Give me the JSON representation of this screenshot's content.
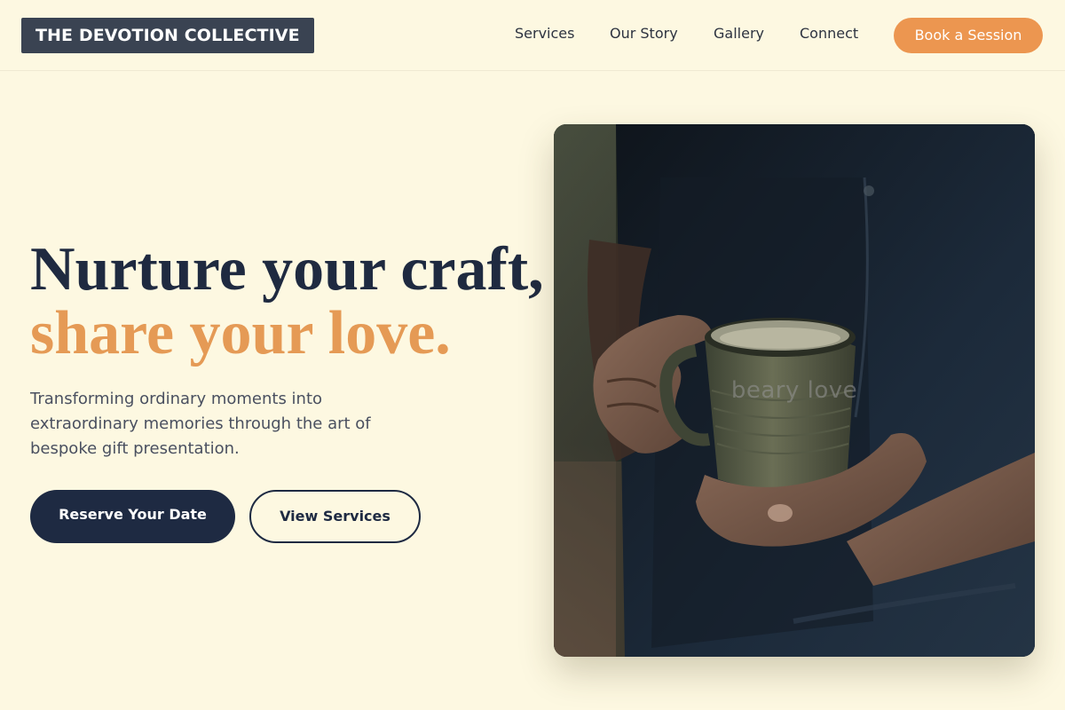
{
  "brand": {
    "name": "THE DEVOTION COLLECTIVE"
  },
  "nav": {
    "items": [
      {
        "label": "Services"
      },
      {
        "label": "Our Story"
      },
      {
        "label": "Gallery"
      },
      {
        "label": "Connect"
      }
    ],
    "cta_label": "Book a Session"
  },
  "hero": {
    "headline_line1": "Nurture your craft,",
    "headline_line2": "share your love.",
    "subtext": "Transforming ordinary moments into extraordinary memories through the art of bespoke gift presentation.",
    "primary_button": "Reserve Your Date",
    "secondary_button": "View Services"
  },
  "image": {
    "description_icon": "photo-artisan-holding-mug",
    "watermark": "beary love"
  },
  "colors": {
    "background": "#fdf8e1",
    "navy": "#1e2a42",
    "accent_orange": "#ec9650",
    "logo_bg": "#3a4352"
  }
}
